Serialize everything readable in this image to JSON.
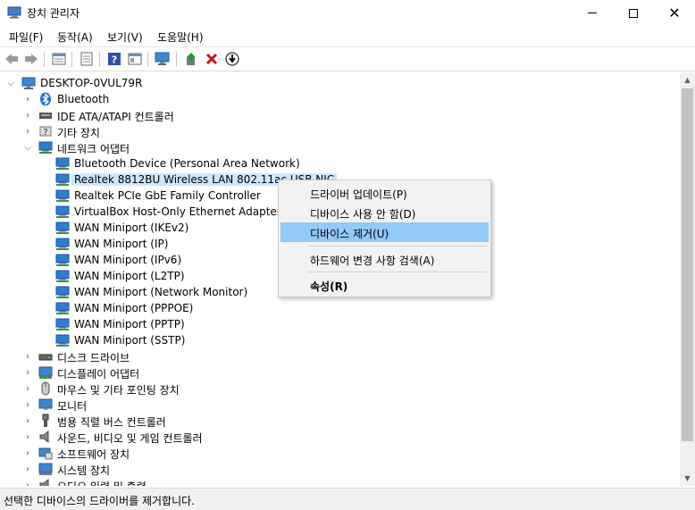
{
  "window": {
    "title": "장치 관리자"
  },
  "menu": [
    "파일(F)",
    "동작(A)",
    "보기(V)",
    "도움말(H)"
  ],
  "tree": {
    "root": "DESKTOP-0VUL79R",
    "rows": [
      {
        "label": "DESKTOP-0VUL79R",
        "level": 0,
        "expanded": true,
        "icon": "computer-icon"
      },
      {
        "label": "Bluetooth",
        "level": 1,
        "expanded": false,
        "icon": "bluetooth-icon"
      },
      {
        "label": "IDE ATA/ATAPI 컨트롤러",
        "level": 1,
        "expanded": false,
        "icon": "ide-controller-icon"
      },
      {
        "label": "기타 장치",
        "level": 1,
        "expanded": false,
        "icon": "unknown-device-icon"
      },
      {
        "label": "네트워크 어댑터",
        "level": 1,
        "expanded": true,
        "icon": "network-adapter-icon"
      },
      {
        "label": "Bluetooth Device (Personal Area Network)",
        "level": 2,
        "icon": "network-adapter-icon"
      },
      {
        "label": "Realtek 8812BU Wireless LAN 802.11ac USB NIC",
        "level": 2,
        "icon": "network-adapter-icon",
        "selected": true
      },
      {
        "label": "Realtek PCIe GbE Family Controller",
        "level": 2,
        "icon": "network-adapter-icon"
      },
      {
        "label": "VirtualBox Host-Only Ethernet Adapter",
        "level": 2,
        "icon": "network-adapter-icon"
      },
      {
        "label": "WAN Miniport (IKEv2)",
        "level": 2,
        "icon": "network-adapter-icon"
      },
      {
        "label": "WAN Miniport (IP)",
        "level": 2,
        "icon": "network-adapter-icon"
      },
      {
        "label": "WAN Miniport (IPv6)",
        "level": 2,
        "icon": "network-adapter-icon"
      },
      {
        "label": "WAN Miniport (L2TP)",
        "level": 2,
        "icon": "network-adapter-icon"
      },
      {
        "label": "WAN Miniport (Network Monitor)",
        "level": 2,
        "icon": "network-adapter-icon"
      },
      {
        "label": "WAN Miniport (PPPOE)",
        "level": 2,
        "icon": "network-adapter-icon"
      },
      {
        "label": "WAN Miniport (PPTP)",
        "level": 2,
        "icon": "network-adapter-icon"
      },
      {
        "label": "WAN Miniport (SSTP)",
        "level": 2,
        "icon": "network-adapter-icon"
      },
      {
        "label": "디스크 드라이브",
        "level": 1,
        "expanded": false,
        "icon": "disk-drive-icon"
      },
      {
        "label": "디스플레이 어댑터",
        "level": 1,
        "expanded": false,
        "icon": "display-adapter-icon"
      },
      {
        "label": "마우스 및 기타 포인팅 장치",
        "level": 1,
        "expanded": false,
        "icon": "mouse-icon"
      },
      {
        "label": "모니터",
        "level": 1,
        "expanded": false,
        "icon": "monitor-icon"
      },
      {
        "label": "범용 직렬 버스 컨트롤러",
        "level": 1,
        "expanded": false,
        "icon": "usb-icon"
      },
      {
        "label": "사운드, 비디오 및 게임 컨트롤러",
        "level": 1,
        "expanded": false,
        "icon": "speaker-icon"
      },
      {
        "label": "소프트웨어 장치",
        "level": 1,
        "expanded": false,
        "icon": "software-device-icon"
      },
      {
        "label": "시스템 장치",
        "level": 1,
        "expanded": false,
        "icon": "system-device-icon"
      },
      {
        "label": "오디오 입력 및 출력",
        "level": 1,
        "expanded": false,
        "icon": "audio-io-icon"
      }
    ]
  },
  "context_menu": {
    "items": [
      {
        "label": "드라이버 업데이트(P)"
      },
      {
        "label": "디바이스 사용 안 함(D)"
      },
      {
        "label": "디바이스 제거(U)",
        "highlighted": true
      },
      {
        "label": "하드웨어 변경 사항 검색(A)"
      },
      {
        "label": "속성(R)",
        "bold": true
      }
    ]
  },
  "status": {
    "text": "선택한 디바이스의 드라이버를 제거합니다."
  },
  "colors": {
    "selection": "#cce8ff",
    "menu_highlight": "#91c9f7",
    "network_icon": "#2a7fd4"
  }
}
